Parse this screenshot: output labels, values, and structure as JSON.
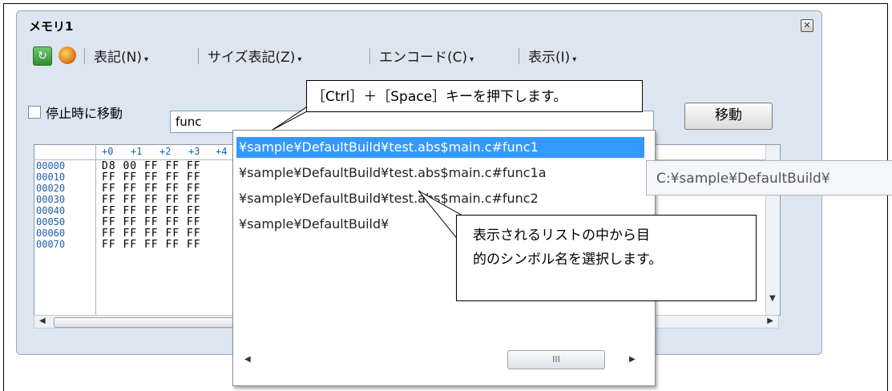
{
  "window": {
    "title": "メモリ1",
    "close_glyph": "✕"
  },
  "toolbar": {
    "menus": [
      "表記(N)",
      "サイズ表記(Z)",
      "エンコード(C)",
      "表示(I)"
    ],
    "caret": "▾",
    "icons": [
      "refresh-icon",
      "palette-icon"
    ]
  },
  "search": {
    "checkbox_label": "停止時に移動",
    "input_value": "func",
    "go_button": "移動"
  },
  "memory_grid": {
    "column_headers": [
      "+0",
      "+1",
      "+2",
      "+3",
      "+4"
    ],
    "addresses": [
      "00000",
      "00010",
      "00020",
      "00030",
      "00040",
      "00050",
      "00060",
      "00070"
    ],
    "rows": [
      "D8 00 FF FF FF",
      "FF FF FF FF FF",
      "FF FF FF FF FF",
      "FF FF FF FF FF",
      "FF FF FF FF FF",
      "FF FF FF FF FF",
      "FF FF FF FF FF",
      "FF FF FF FF FF"
    ],
    "ascii_fragments": [
      "",
      "",
      "????????? ?",
      "?",
      "?",
      "?",
      "?",
      "????????????"
    ]
  },
  "completion_list": {
    "items": [
      "¥sample¥DefaultBuild¥test.abs$main.c#func1",
      "¥sample¥DefaultBuild¥test.abs$main.c#func1a",
      "¥sample¥DefaultBuild¥test.abs$main.c#func2",
      "¥sample¥DefaultBuild¥"
    ],
    "selected_index": 0,
    "scroll_thumb_glyph": "III"
  },
  "tooltip": {
    "text": "C:¥sample¥DefaultBuild¥"
  },
  "callouts": {
    "ctrl_space": "［Ctrl］＋［Space］キーを押下します。",
    "select_symbol_line1": "表示されるリストの中から目",
    "select_symbol_line2": "的のシンボル名を選択します。"
  }
}
